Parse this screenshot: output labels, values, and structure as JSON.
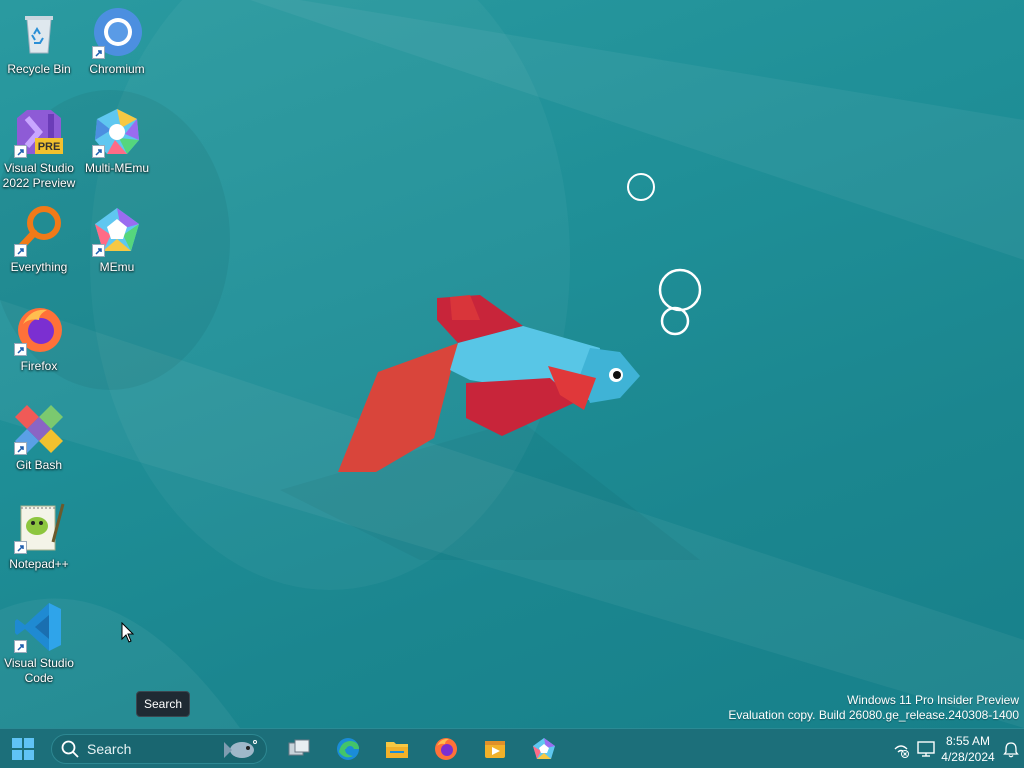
{
  "desktop": {
    "icons": [
      {
        "label": "Recycle Bin"
      },
      {
        "label": "Chromium"
      },
      {
        "label": "Visual Studio\n2022 Preview"
      },
      {
        "label": "Multi-MEmu"
      },
      {
        "label": "Everything"
      },
      {
        "label": "MEmu"
      },
      {
        "label": "Firefox"
      },
      {
        "label": "Git Bash"
      },
      {
        "label": "Notepad++"
      },
      {
        "label": "Visual Studio\nCode"
      }
    ],
    "vs_badge": "PRE",
    "watermark": {
      "line1": "Windows 11 Pro Insider Preview",
      "line2": "Evaluation copy. Build 26080.ge_release.240308-1400"
    }
  },
  "tooltip": {
    "text": "Search"
  },
  "taskbar": {
    "search_placeholder": "Search",
    "pinned": [
      "task-view-icon",
      "edge-icon",
      "file-explorer-icon",
      "firefox-icon",
      "media-player-icon",
      "memu-icon"
    ],
    "tray": {
      "time": "8:55 AM",
      "date": "4/28/2024"
    }
  },
  "colors": {
    "taskbar": "#1c6f7a",
    "desktop": "#1f8f97",
    "fish_body": "#58c6e6",
    "fish_fin": "#c8253a"
  }
}
